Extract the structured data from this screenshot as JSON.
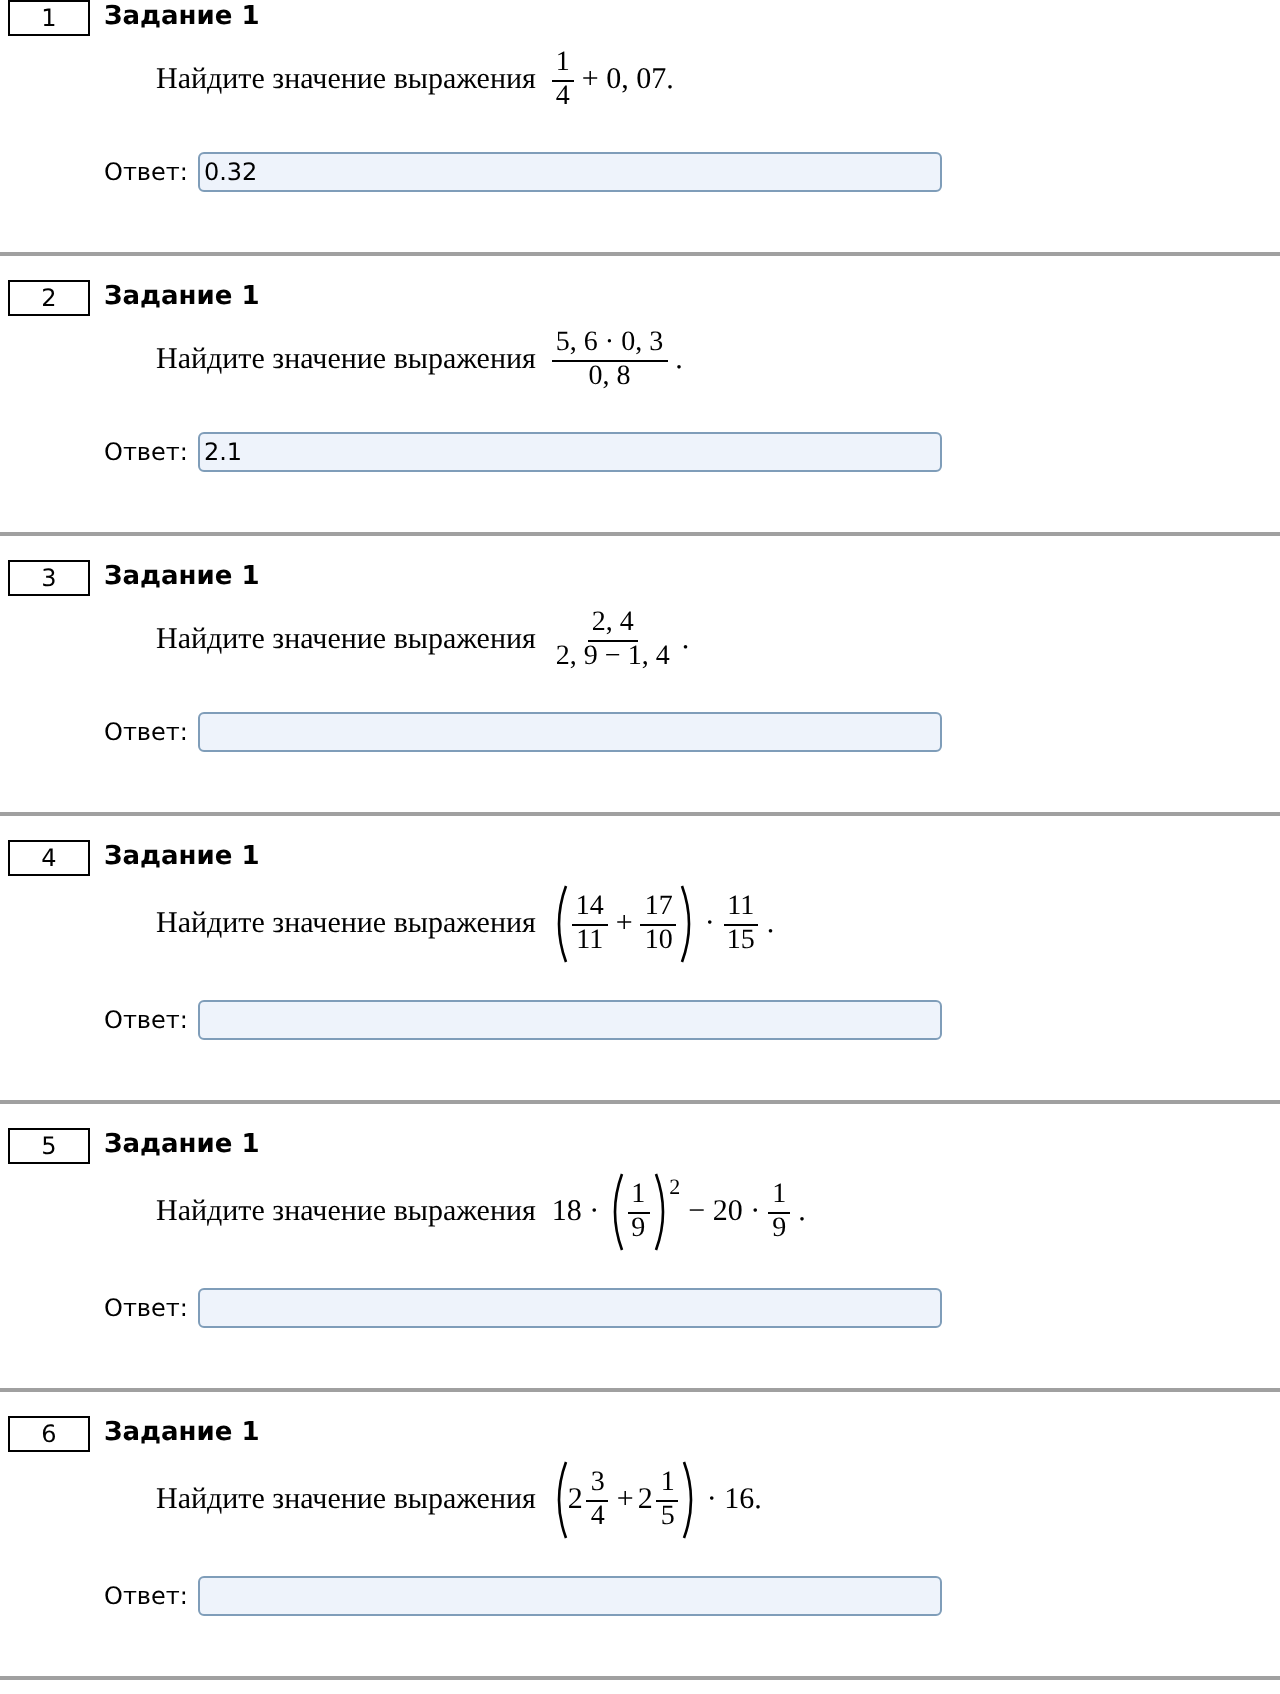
{
  "tasks": [
    {
      "number": "1",
      "title": "Задание 1",
      "prompt": "Найдите значение выражения",
      "expression": [
        {
          "kind": "frac",
          "num": "1",
          "den": "4"
        },
        {
          "kind": "text",
          "text": "+ 0, 07."
        }
      ],
      "answer_label": "Ответ:",
      "answer": "0.32"
    },
    {
      "number": "2",
      "title": "Задание 1",
      "prompt": "Найдите значение выражения",
      "expression": [
        {
          "kind": "frac",
          "num": "5, 6 · 0, 3",
          "den": "0, 8"
        },
        {
          "kind": "text",
          "text": "."
        }
      ],
      "answer_label": "Ответ:",
      "answer": "2.1"
    },
    {
      "number": "3",
      "title": "Задание 1",
      "prompt": "Найдите значение выражения",
      "expression": [
        {
          "kind": "frac",
          "num": "2, 4",
          "den": "2, 9 − 1, 4"
        },
        {
          "kind": "text",
          "text": "."
        }
      ],
      "answer_label": "Ответ:"
    },
    {
      "number": "4",
      "title": "Задание 1",
      "prompt": "Найдите значение выражения",
      "expression": [
        {
          "kind": "paren",
          "children": [
            {
              "kind": "frac",
              "num": "14",
              "den": "11"
            },
            {
              "kind": "text",
              "text": "+"
            },
            {
              "kind": "frac",
              "num": "17",
              "den": "10"
            }
          ]
        },
        {
          "kind": "text",
          "text": "·"
        },
        {
          "kind": "frac",
          "num": "11",
          "den": "15"
        },
        {
          "kind": "text",
          "text": "."
        }
      ],
      "answer_label": "Ответ:"
    },
    {
      "number": "5",
      "title": "Задание 1",
      "prompt": "Найдите значение выражения",
      "expression": [
        {
          "kind": "text",
          "text": "18 ·"
        },
        {
          "kind": "paren",
          "children": [
            {
              "kind": "frac",
              "num": "1",
              "den": "9"
            }
          ],
          "sup": "2"
        },
        {
          "kind": "text",
          "text": "− 20 ·"
        },
        {
          "kind": "frac",
          "num": "1",
          "den": "9"
        },
        {
          "kind": "text",
          "text": "."
        }
      ],
      "answer_label": "Ответ:"
    },
    {
      "number": "6",
      "title": "Задание 1",
      "prompt": "Найдите значение выражения",
      "expression": [
        {
          "kind": "paren",
          "children": [
            {
              "kind": "mixed",
              "whole": "2",
              "num": "3",
              "den": "4"
            },
            {
              "kind": "text",
              "text": "+"
            },
            {
              "kind": "mixed",
              "whole": "2",
              "num": "1",
              "den": "5"
            }
          ]
        },
        {
          "kind": "text",
          "text": "· 16."
        }
      ],
      "answer_label": "Ответ:"
    }
  ]
}
